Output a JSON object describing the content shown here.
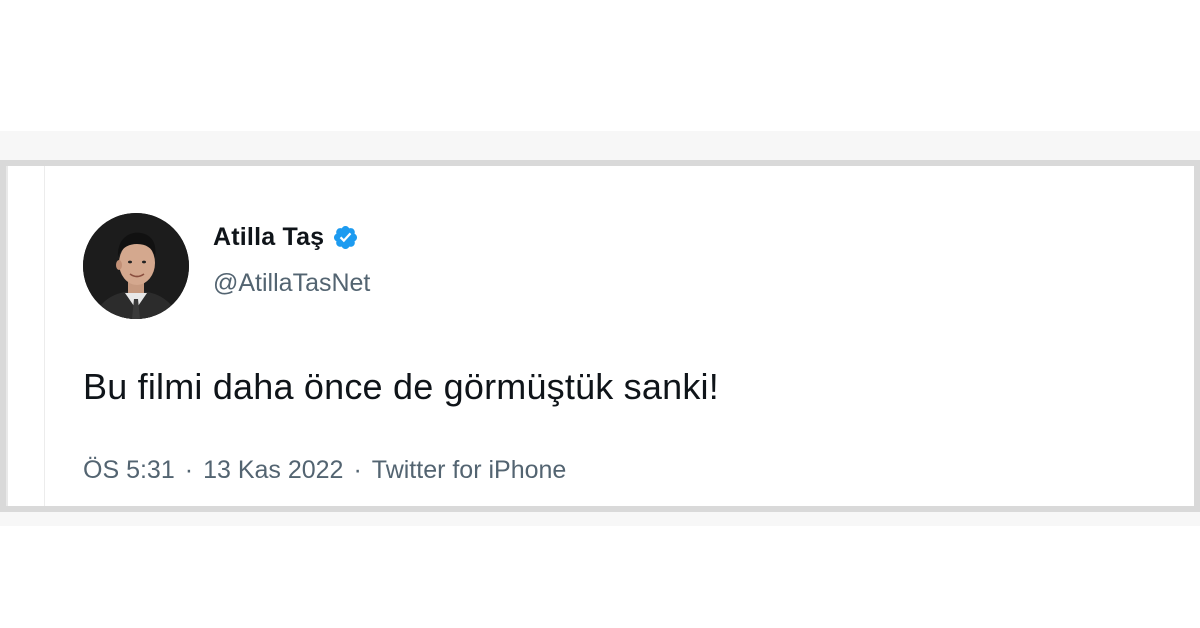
{
  "tweet": {
    "author": {
      "display_name": "Atilla Taş",
      "handle": "@AtillaTasNet",
      "verified": true,
      "verified_icon": "verified-badge-icon",
      "avatar_icon": "avatar"
    },
    "text": "Bu filmi daha önce de görmüştük sanki!",
    "time": "ÖS 5:31",
    "separator": "·",
    "date": "13 Kas 2022",
    "source": "Twitter for iPhone"
  },
  "colors": {
    "primary_text": "#0f1419",
    "secondary_text": "#536471",
    "verified_blue": "#1d9bf0",
    "frame_gray": "#d9d9d9"
  }
}
